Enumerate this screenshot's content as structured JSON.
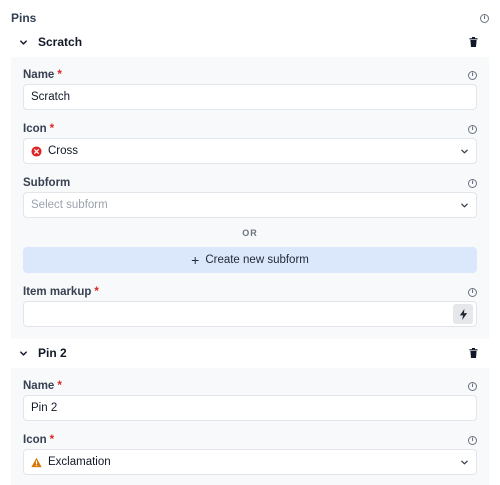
{
  "section": {
    "title": "Pins"
  },
  "pins": [
    {
      "title": "Scratch",
      "name_label": "Name",
      "name_value": "Scratch",
      "icon_label": "Icon",
      "icon_value": "Cross",
      "icon_name": "cross-circle-icon",
      "icon_color": "#e02424",
      "subform_label": "Subform",
      "subform_placeholder": "Select subform",
      "or_text": "OR",
      "create_label": "Create new subform",
      "markup_label": "Item markup"
    },
    {
      "title": "Pin 2",
      "name_label": "Name",
      "name_value": "Pin 2",
      "icon_label": "Icon",
      "icon_value": "Exclamation",
      "icon_name": "warning-triangle-icon",
      "icon_color": "#d97706"
    }
  ],
  "required_mark": "*",
  "colors": {
    "accent_button": "#dbe7fb",
    "required": "#dc2626",
    "panel": "#f8f9fb"
  }
}
